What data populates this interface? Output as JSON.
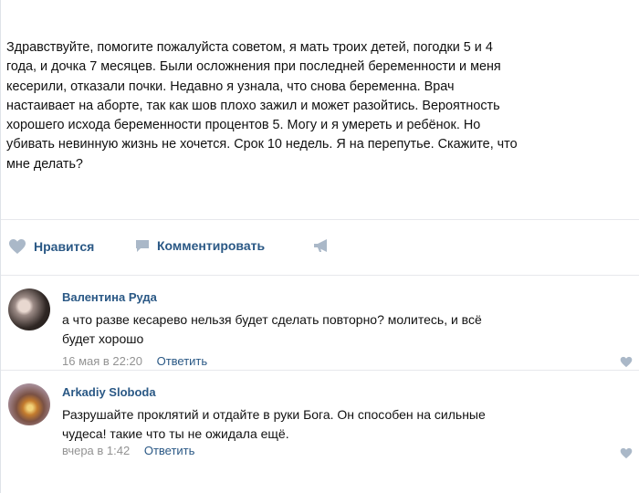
{
  "post": {
    "text_lines": [
      "Здравствуйте, помогите пожалуйста советом, я мать троих детей, погодки 5 и 4",
      "года, и дочка 7 месяцев. Были осложнения при последней беременности и меня",
      "кесерили, отказали почки. Недавно я узнала, что снова беременна. Врач",
      "настаивает на аборте, так как шов плохо зажил и может разойтись. Вероятность",
      "хорошего исхода беременности процентов 5. Могу и я умереть и ребёнок. Но",
      "убивать невинную жизнь не хочется. Срок 10 недель. Я на перепутье. Скажите, что",
      "мне делать?"
    ]
  },
  "actions": {
    "like_label": "Нравится",
    "comment_label": "Комментировать"
  },
  "comments": [
    {
      "author": "Валентина Руда",
      "text_lines": [
        "а что разве кесарево нельзя будет сделать повторно? молитесь, и всё",
        "будет хорошо"
      ],
      "date": "16 мая в 22:20",
      "reply_label": "Ответить"
    },
    {
      "author": "Arkadiy Sloboda",
      "text_lines": [
        "Разрушайте проклятий и отдайте в руки Бога. Он способен на сильные",
        "чудеса! такие что ты не ожидала ещё."
      ],
      "date": "вчера в 1:42",
      "reply_label": "Ответить"
    }
  ],
  "icons": {
    "like": "heart-icon",
    "comment": "comment-icon",
    "share": "megaphone-icon",
    "comment_like": "heart-icon"
  },
  "colors": {
    "link": "#2a5885",
    "icon": "#aab8c8",
    "muted": "#939393",
    "divider": "#e7e8ec"
  }
}
